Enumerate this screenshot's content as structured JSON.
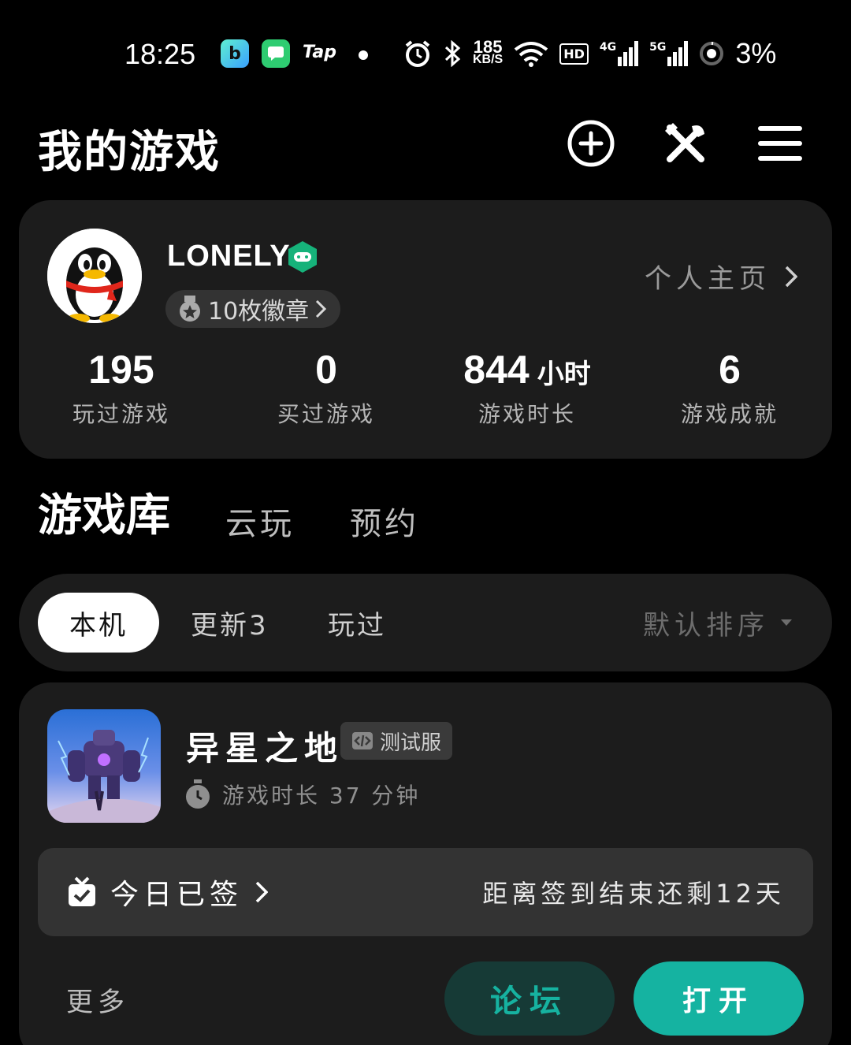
{
  "status_bar": {
    "time": "18:25",
    "app_tap": "Tap",
    "net_speed_value": "185",
    "net_speed_unit": "KB/S",
    "hd_label": "HD",
    "net_4g": "4G",
    "net_5g": "5G",
    "battery": "3%"
  },
  "header": {
    "title": "我的游戏"
  },
  "profile": {
    "username": "LONELY",
    "badges_label": "10枚徽章",
    "home_link": "个人主页",
    "stats": [
      {
        "value": "195",
        "unit": "",
        "label": "玩过游戏"
      },
      {
        "value": "0",
        "unit": "",
        "label": "买过游戏"
      },
      {
        "value": "844",
        "unit": "小时",
        "label": "游戏时长"
      },
      {
        "value": "6",
        "unit": "",
        "label": "游戏成就"
      }
    ]
  },
  "tabs": [
    {
      "label": "游戏库",
      "active": true
    },
    {
      "label": "云玩",
      "active": false
    },
    {
      "label": "预约",
      "active": false
    }
  ],
  "filters": {
    "chips": [
      {
        "label": "本机",
        "active": true
      },
      {
        "label": "更新3",
        "active": false
      },
      {
        "label": "玩过",
        "active": false
      }
    ],
    "sort_label": "默认排序"
  },
  "game": {
    "name": "异星之地",
    "badge": "测试服",
    "playtime": "游戏时长 37 分钟",
    "checkin_status": "今日已签",
    "checkin_remaining": "距离签到结束还剩12天",
    "more_label": "更多",
    "forum_label": "论坛",
    "open_label": "打开"
  },
  "colors": {
    "accent": "#15b3a1",
    "card_bg": "#1c1c1c",
    "background": "#000000"
  }
}
